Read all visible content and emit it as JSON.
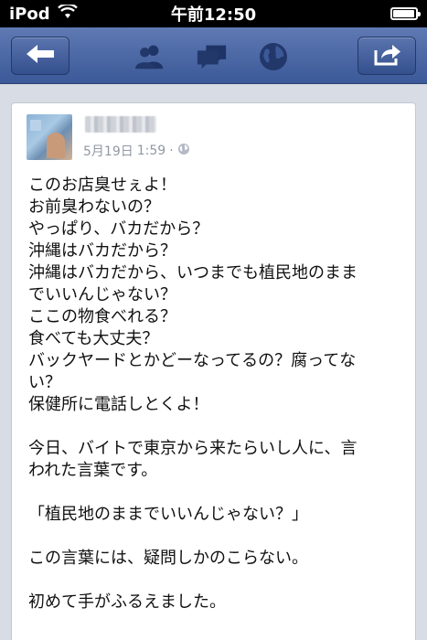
{
  "status_bar": {
    "carrier": "iPod",
    "time": "午前12:50",
    "battery_level": 0.95,
    "icons": [
      "wifi-icon",
      "battery-icon"
    ]
  },
  "nav_bar": {
    "back_icon": "back-arrow-icon",
    "center_icons": [
      "friends-icon",
      "messages-icon",
      "globe-icon"
    ],
    "share_icon": "share-icon",
    "color": "#3b5998"
  },
  "post": {
    "date": "5月19日",
    "time": "1:59",
    "separator": "·",
    "privacy_icon": "public-globe-icon",
    "lines": [
      "このお店臭せぇよ！",
      "お前臭わないの？",
      "やっぱり、バカだから？",
      "沖縄はバカだから？",
      "沖縄はバカだから、いつまでも植民地のまま",
      "でいいんじゃない？",
      "ここの物食べれる？",
      "食べても大丈夫？",
      "バックヤードとかどーなってるの？腐ってな",
      "い？",
      "保健所に電話しとくよ！",
      "",
      "今日、バイトで東京から来たらいし人に、言",
      "われた言葉です。",
      "",
      "「植民地のままでいいんじゃない？」",
      "",
      "この言葉には、疑問しかのこらない。",
      "",
      "初めて手がふるえました。"
    ]
  }
}
